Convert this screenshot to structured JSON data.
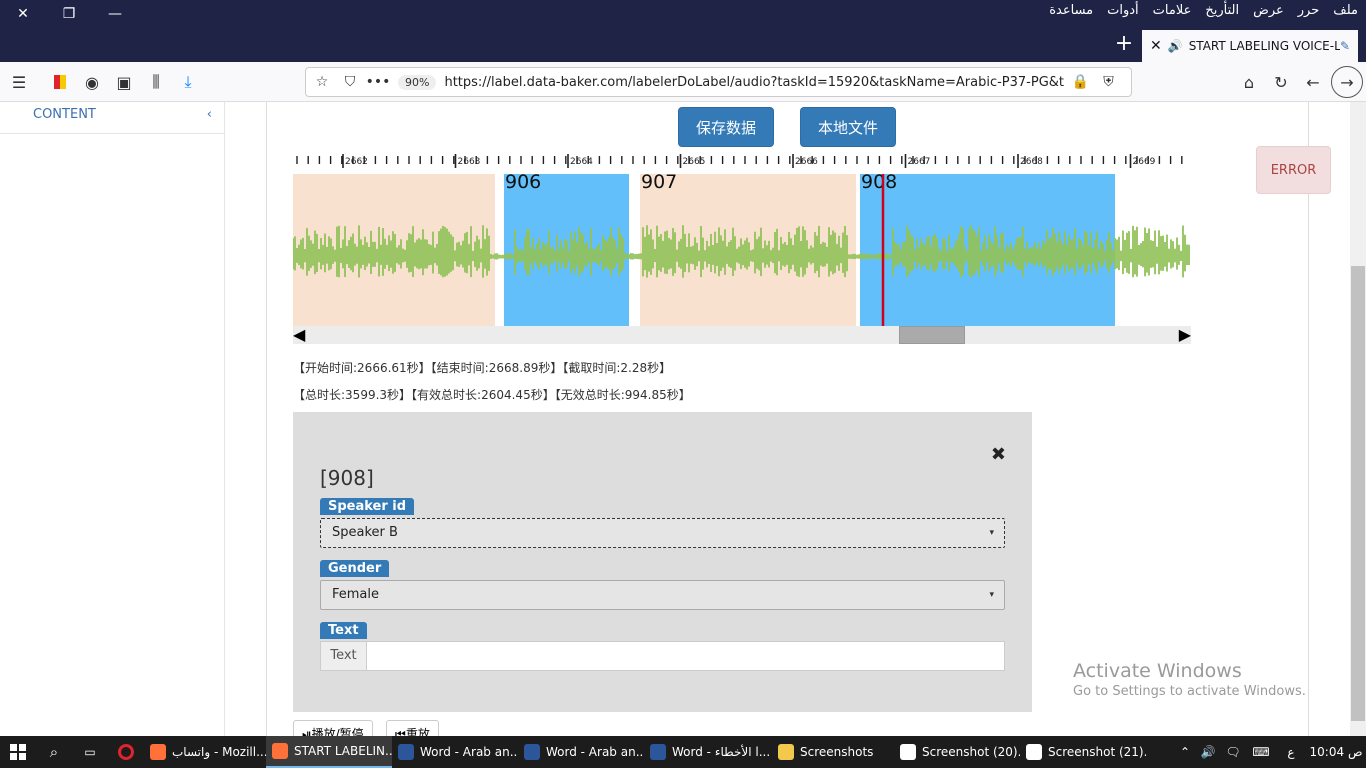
{
  "browser": {
    "menu": [
      "ملف",
      "حرر",
      "عرض",
      "التأريخ",
      "علامات",
      "أدوات",
      "مساعدة"
    ],
    "tab_title": "START LABELING VOICE-LA",
    "url": "https://label.data-baker.com/labelerDoLabel/audio?taskId=15920&taskName=Arabic-P37-PG&type=",
    "zoom": "90%"
  },
  "sidebar": {
    "header": "CONTENT",
    "collapse_glyph": "‹"
  },
  "toolbar": {
    "save_label": "保存数据",
    "local_label": "本地文件"
  },
  "ruler": {
    "ticks": [
      "2662",
      "2663",
      "2664",
      "2665",
      "2666",
      "2667",
      "2668",
      "2669"
    ]
  },
  "segments": [
    {
      "label": "",
      "color": "#f9e1cf"
    },
    {
      "label": "906",
      "color": "#63bffa"
    },
    {
      "label": "907",
      "color": "#f9e1cf"
    },
    {
      "label": "908",
      "color": "#63bffa"
    }
  ],
  "colors": {
    "wave": "#93c35a",
    "cursor": "#d0021b",
    "primary": "#337ab7"
  },
  "scroll": {
    "thumb_position": 0.69,
    "left_arrow": "◀",
    "right_arrow": "▶"
  },
  "info": {
    "line1": "【开始时间:2666.61秒】【结束时间:2668.89秒】【截取时间:2.28秒】",
    "line2": "【总时长:3599.3秒】【有效总时长:2604.45秒】【无效总时长:994.85秒】"
  },
  "error_label": "ERROR",
  "panel": {
    "title": "[908]",
    "close_glyph": "✖",
    "speaker_label": "Speaker id",
    "speaker_value": "Speaker B",
    "gender_label": "Gender",
    "gender_value": "Female",
    "text_label": "Text",
    "text_addon": "Text",
    "text_value": "",
    "caret": "▾"
  },
  "bottom_buttons": {
    "play": "播放/暂停",
    "reset": "重放"
  },
  "watermark": {
    "line1": "Activate Windows",
    "line2": "Go to Settings to activate Windows."
  },
  "taskbar": {
    "apps": [
      {
        "label": "واتساب - Mozill...",
        "color": "#ff7139"
      },
      {
        "label": "START LABELIN...",
        "color": "#ff7139",
        "active": true
      },
      {
        "label": "Word - Arab an...",
        "color": "#2b579a"
      },
      {
        "label": "Word - Arab an...",
        "color": "#2b579a"
      },
      {
        "label": "Word - الأخطاء l...",
        "color": "#2b579a"
      },
      {
        "label": "Screenshots",
        "color": "#f2c94c"
      },
      {
        "label": "Screenshot (20)...",
        "color": "#ffffff"
      },
      {
        "label": "Screenshot (21)...",
        "color": "#ffffff"
      }
    ],
    "lang": "ع",
    "clock": "10:04 ص"
  }
}
